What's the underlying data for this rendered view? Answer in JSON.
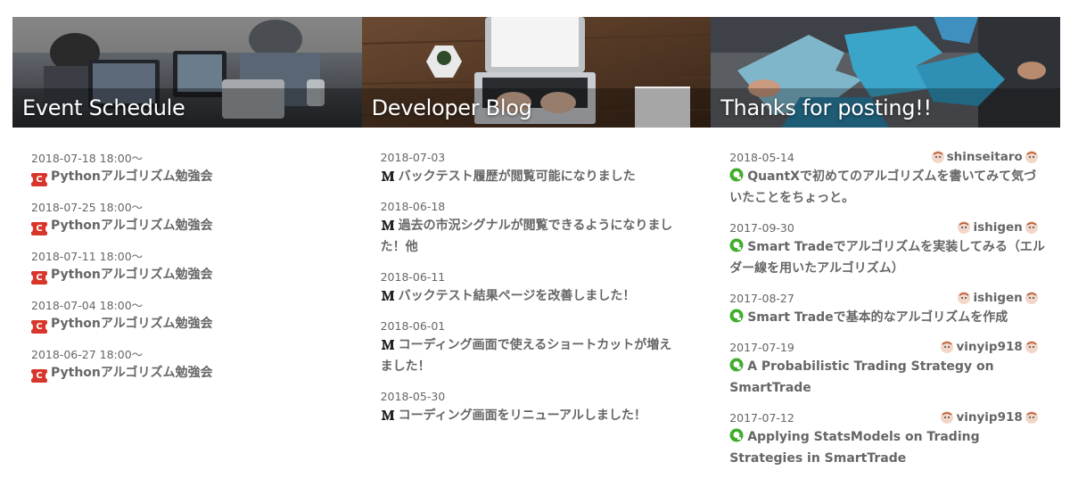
{
  "colors": {
    "text": "#666666",
    "event_icon": "#d8362b",
    "post_icon": "#3fae2a"
  },
  "events": {
    "heading": "Event Schedule",
    "items": [
      {
        "date": "2018-07-18 18:00〜",
        "icon": "ticket-c-icon",
        "title": "Pythonアルゴリズム勉強会"
      },
      {
        "date": "2018-07-25 18:00〜",
        "icon": "ticket-c-icon",
        "title": "Pythonアルゴリズム勉強会"
      },
      {
        "date": "2018-07-11 18:00〜",
        "icon": "ticket-c-icon",
        "title": "Pythonアルゴリズム勉強会"
      },
      {
        "date": "2018-07-04 18:00〜",
        "icon": "ticket-c-icon",
        "title": "Pythonアルゴリズム勉強会"
      },
      {
        "date": "2018-06-27 18:00〜",
        "icon": "ticket-c-icon",
        "title": "Pythonアルゴリズム勉強会"
      }
    ]
  },
  "blog": {
    "heading": "Developer Blog",
    "items": [
      {
        "date": "2018-07-03",
        "icon": "medium-icon",
        "title": "バックテスト履歴が閲覧可能になりました"
      },
      {
        "date": "2018-06-18",
        "icon": "medium-icon",
        "title": "過去の市況シグナルが閲覧できるようになりました！他"
      },
      {
        "date": "2018-06-11",
        "icon": "medium-icon",
        "title": "バックテスト結果ページを改善しました！"
      },
      {
        "date": "2018-06-01",
        "icon": "medium-icon",
        "title": "コーディング画面で使えるショートカットが増えました！"
      },
      {
        "date": "2018-05-30",
        "icon": "medium-icon",
        "title": "コーディング画面をリニューアルしました！"
      }
    ]
  },
  "posts": {
    "heading": "Thanks for posting!!",
    "items": [
      {
        "date": "2018-05-14",
        "author": "shinseitaro",
        "icon": "qiita-icon",
        "title": "QuantXで初めてのアルゴリズムを書いてみて気づいたことをちょっと。"
      },
      {
        "date": "2017-09-30",
        "author": "ishigen",
        "icon": "qiita-icon",
        "title": "Smart Tradeでアルゴリズムを実装してみる（エルダー線を用いたアルゴリズム）"
      },
      {
        "date": "2017-08-27",
        "author": "ishigen",
        "icon": "qiita-icon",
        "title": "Smart Tradeで基本的なアルゴリズムを作成"
      },
      {
        "date": "2017-07-19",
        "author": "vinyip918",
        "icon": "qiita-icon",
        "title": "A Probabilistic Trading Strategy on SmartTrade"
      },
      {
        "date": "2017-07-12",
        "author": "vinyip918",
        "icon": "qiita-icon",
        "title": "Applying StatsModels on Trading Strategies in SmartTrade"
      }
    ]
  }
}
